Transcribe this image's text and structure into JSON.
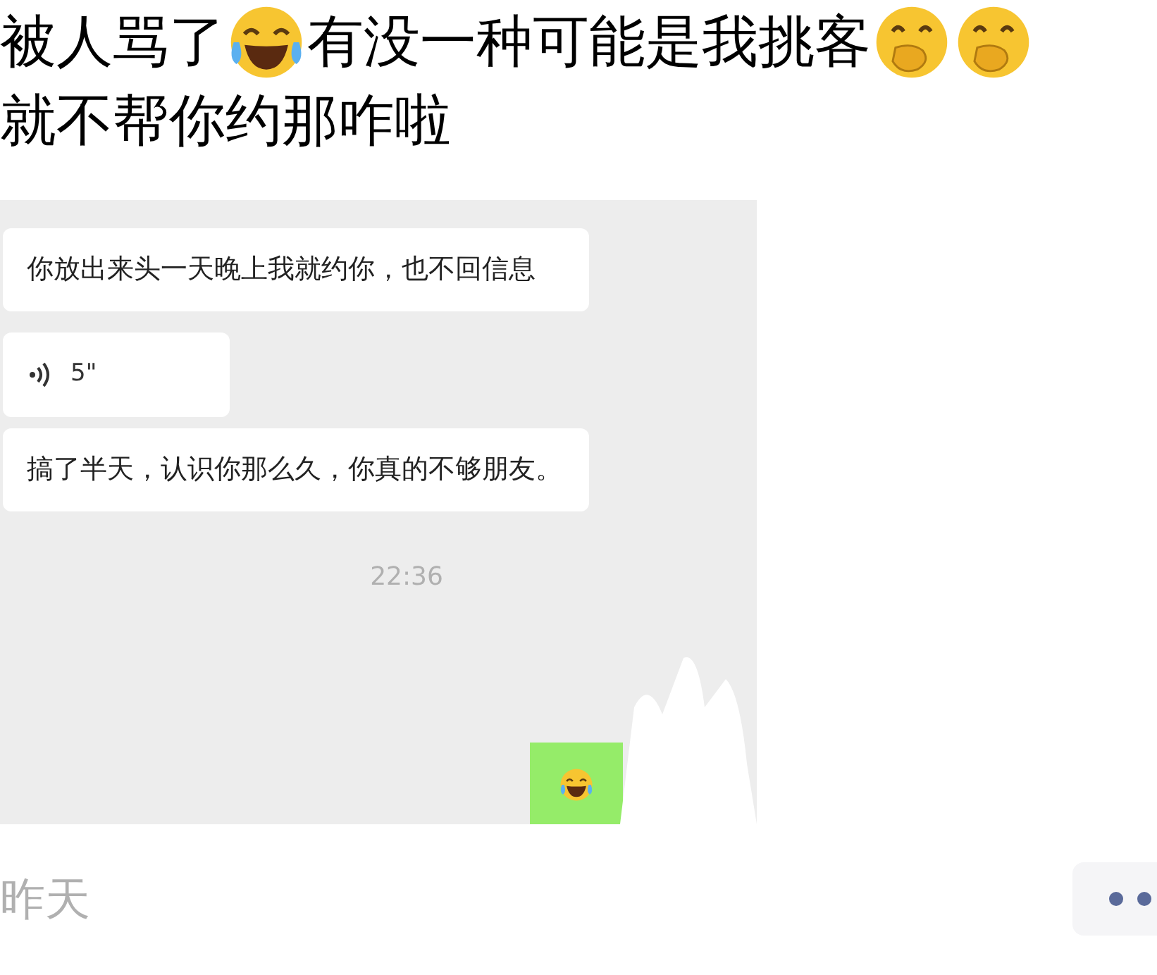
{
  "post": {
    "lines": [
      [
        {
          "kind": "text",
          "text": "被人骂了"
        },
        {
          "kind": "laughing"
        },
        {
          "kind": "text",
          "text": "有没一种可能是我挑客"
        },
        {
          "kind": "giggling"
        },
        {
          "kind": "giggling"
        }
      ],
      [
        {
          "kind": "text",
          "text": "就不帮你约那咋啦"
        }
      ]
    ]
  },
  "chat": {
    "messages": [
      {
        "kind": "text",
        "text": "你放出来头一天晚上我就约你，也不回信息"
      },
      {
        "kind": "voice",
        "duration": "5\""
      },
      {
        "kind": "text",
        "text": "搞了半天，认识你那么久，你真的不够朋友。"
      },
      {
        "kind": "time",
        "text": "22:36"
      },
      {
        "kind": "sticker"
      }
    ]
  },
  "footer": {
    "date": "昨天"
  }
}
